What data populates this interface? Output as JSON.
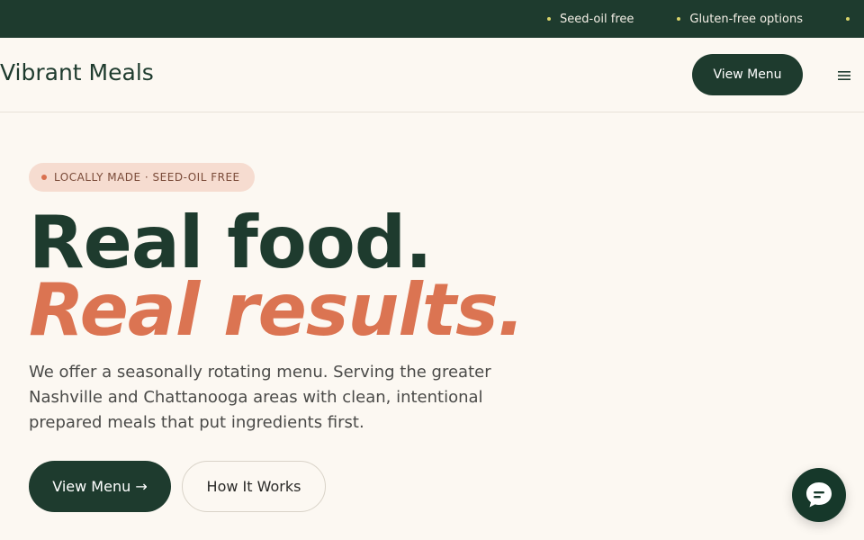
{
  "announcement": {
    "items": [
      {
        "label": "Seed-oil free"
      },
      {
        "label": "Gluten-free options"
      }
    ]
  },
  "header": {
    "brand": "Vibrant Meals",
    "cta_label": "View Menu",
    "menu_icon": "hamburger-menu-icon"
  },
  "hero": {
    "badge": "LOCALLY MADE · SEED-OIL FREE",
    "headline_line1": "Real food.",
    "headline_line2": "Real results.",
    "lead": "We offer a seasonally rotating menu. Serving the greater Nashville and Chattanooga areas with clean, intentional prepared meals that put ingredients first.",
    "primary_cta": "View Menu →",
    "secondary_cta": "How It Works"
  },
  "chat": {
    "icon": "chat-bubble-icon"
  },
  "colors": {
    "brand_green": "#1e3b2e",
    "accent_terracotta": "#db7452",
    "background": "#fcf8f2",
    "badge_bg": "#f6dcd0"
  }
}
